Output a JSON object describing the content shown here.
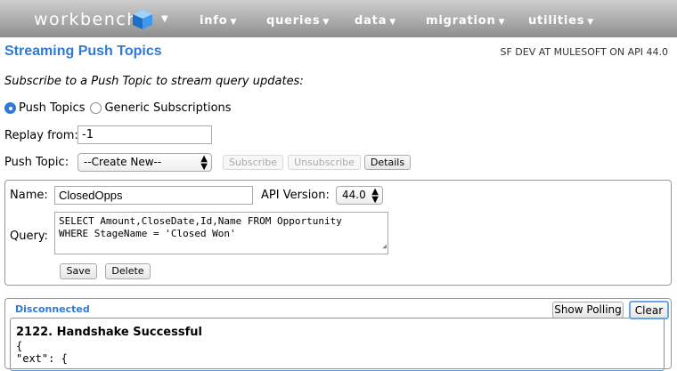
{
  "nav": {
    "brand": "workbench",
    "menu": [
      {
        "label": "info"
      },
      {
        "label": "queries"
      },
      {
        "label": "data"
      },
      {
        "label": "migration"
      },
      {
        "label": "utilities"
      }
    ]
  },
  "header": {
    "title": "Streaming Push Topics",
    "env": "SF DEV AT MULESOFT ON API 44.0"
  },
  "intro": "Subscribe to a Push Topic to stream query updates:",
  "mode": {
    "options": [
      "Push Topics",
      "Generic Subscriptions"
    ],
    "selected": "Push Topics"
  },
  "replay": {
    "label": "Replay from:",
    "value": "-1"
  },
  "push_topic": {
    "label": "Push Topic:",
    "selected": "--Create New--",
    "subscribe_label": "Subscribe",
    "unsubscribe_label": "Unsubscribe",
    "details_label": "Details"
  },
  "editor": {
    "name_label": "Name:",
    "name_value": "ClosedOpps",
    "api_label": "API Version:",
    "api_value": "44.0",
    "query_label": "Query:",
    "query_value": "SELECT Amount,CloseDate,Id,Name FROM Opportunity\nWHERE StageName = 'Closed Won'",
    "save_label": "Save",
    "delete_label": "Delete"
  },
  "stream": {
    "status": "Disconnected",
    "show_polling_label": "Show Polling",
    "clear_label": "Clear",
    "log_title": "2122. Handshake Successful",
    "log_line1": "{",
    "log_line2": "  \"ext\": {"
  },
  "colors": {
    "accent": "#2f7ad6",
    "nav_top": "#cfcfcf",
    "nav_bottom": "#8e8e8e"
  },
  "icons": {
    "brand_logo": "cube-icon",
    "dropdown": "caret-down-icon"
  }
}
